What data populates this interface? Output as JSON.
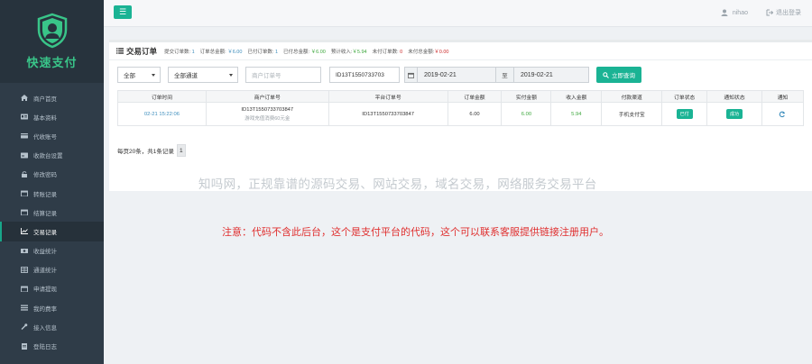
{
  "brand": {
    "name": "快速支付"
  },
  "sidebar": {
    "items": [
      {
        "label": "商户首页",
        "icon": "home-icon"
      },
      {
        "label": "基本资料",
        "icon": "id-card-icon"
      },
      {
        "label": "代收账号",
        "icon": "wallet-icon"
      },
      {
        "label": "收款台设置",
        "icon": "card-icon"
      },
      {
        "label": "修改密码",
        "icon": "lock-icon"
      },
      {
        "label": "转账记录",
        "icon": "calendar-icon"
      },
      {
        "label": "结算记录",
        "icon": "calendar-icon"
      },
      {
        "label": "交易记录",
        "icon": "chart-icon",
        "active": true
      },
      {
        "label": "收益统计",
        "icon": "money-icon"
      },
      {
        "label": "通道统计",
        "icon": "grid-icon"
      },
      {
        "label": "申请提现",
        "icon": "calendar-icon"
      },
      {
        "label": "我的费率",
        "icon": "list-icon"
      },
      {
        "label": "接入信息",
        "icon": "wrench-icon"
      },
      {
        "label": "登陆日志",
        "icon": "doc-icon"
      }
    ]
  },
  "topbar": {
    "menu_icon": "☰",
    "username": "nihao",
    "logout_label": "退出登录"
  },
  "panel": {
    "title": "交易订单",
    "stats": [
      {
        "label": "提交订单数:",
        "value": "1",
        "tone": "blue"
      },
      {
        "label": "订单总金额:",
        "value": "￥6.00",
        "tone": "blue"
      },
      {
        "label": "已付订单数:",
        "value": "1",
        "tone": "blue"
      },
      {
        "label": "已付总金额:",
        "value": "￥6.00",
        "tone": "green"
      },
      {
        "label": "预计收入:",
        "value": "￥5.94",
        "tone": "green"
      },
      {
        "label": "未付订单数:",
        "value": "0",
        "tone": "red"
      },
      {
        "label": "未付总金额:",
        "value": "￥0.00",
        "tone": "red"
      }
    ]
  },
  "filters": {
    "status_select": "全部",
    "channel_select": "全部通道",
    "merchant_order_placeholder": "商户订单号",
    "platform_order_value": "ID13T1550733703",
    "date_from": "2019-02-21",
    "date_sep": "至",
    "date_to": "2019-02-21",
    "search_label": "立即查询"
  },
  "table": {
    "headers": [
      "订单时间",
      "商户订单号",
      "平台订单号",
      "订单金额",
      "实付金额",
      "收入金额",
      "付款渠道",
      "订单状态",
      "通知状态",
      "通知"
    ],
    "rows": [
      {
        "time": "02-21 15:22:06",
        "merchant_order": "ID13T1550733703847",
        "merchant_sub": "游戏充值消费60元金",
        "platform_order": "ID13T1550733703847",
        "amount": "6.00",
        "paid": "6.00",
        "income": "5.94",
        "channel": "手机支付宝",
        "order_status": "已付",
        "notify_status": "成功"
      }
    ]
  },
  "pager": {
    "summary": "每页20条，共1条记录",
    "page": "1"
  },
  "watermark": "知吗网，正规靠谱的源码交易、网站交易，域名交易，网络服务交易平台",
  "notice": "注意：代码不含此后台，这个是支付平台的代码，这个可以联系客服提供链接注册用户。",
  "colors": {
    "accent": "#1ab394",
    "sidebar": "#2f3c48",
    "notice": "#e0302f"
  }
}
